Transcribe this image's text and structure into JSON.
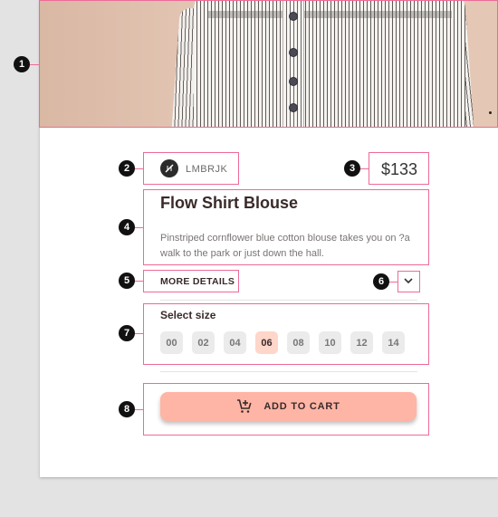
{
  "product": {
    "brand": "LMBRJK",
    "price": "$133",
    "title": "Flow Shirt Blouse",
    "description": "Pinstriped cornflower blue cotton blouse takes you on ?a walk to the park or just down the hall.",
    "more_details_label": "MORE DETAILS"
  },
  "sizes": {
    "label": "Select size",
    "options": [
      "00",
      "02",
      "04",
      "06",
      "08",
      "10",
      "12",
      "14"
    ],
    "selected": "06"
  },
  "cart": {
    "label": "ADD TO CART"
  },
  "markers": [
    "1",
    "2",
    "3",
    "4",
    "5",
    "6",
    "7",
    "8"
  ],
  "icons": [
    "brand-logo-icon",
    "chevron-down-icon",
    "add-shopping-cart-icon"
  ],
  "colors": {
    "accent": "#ffb5a5",
    "selected_chip": "#ffd6ca",
    "annotation": "#ee6a98"
  }
}
